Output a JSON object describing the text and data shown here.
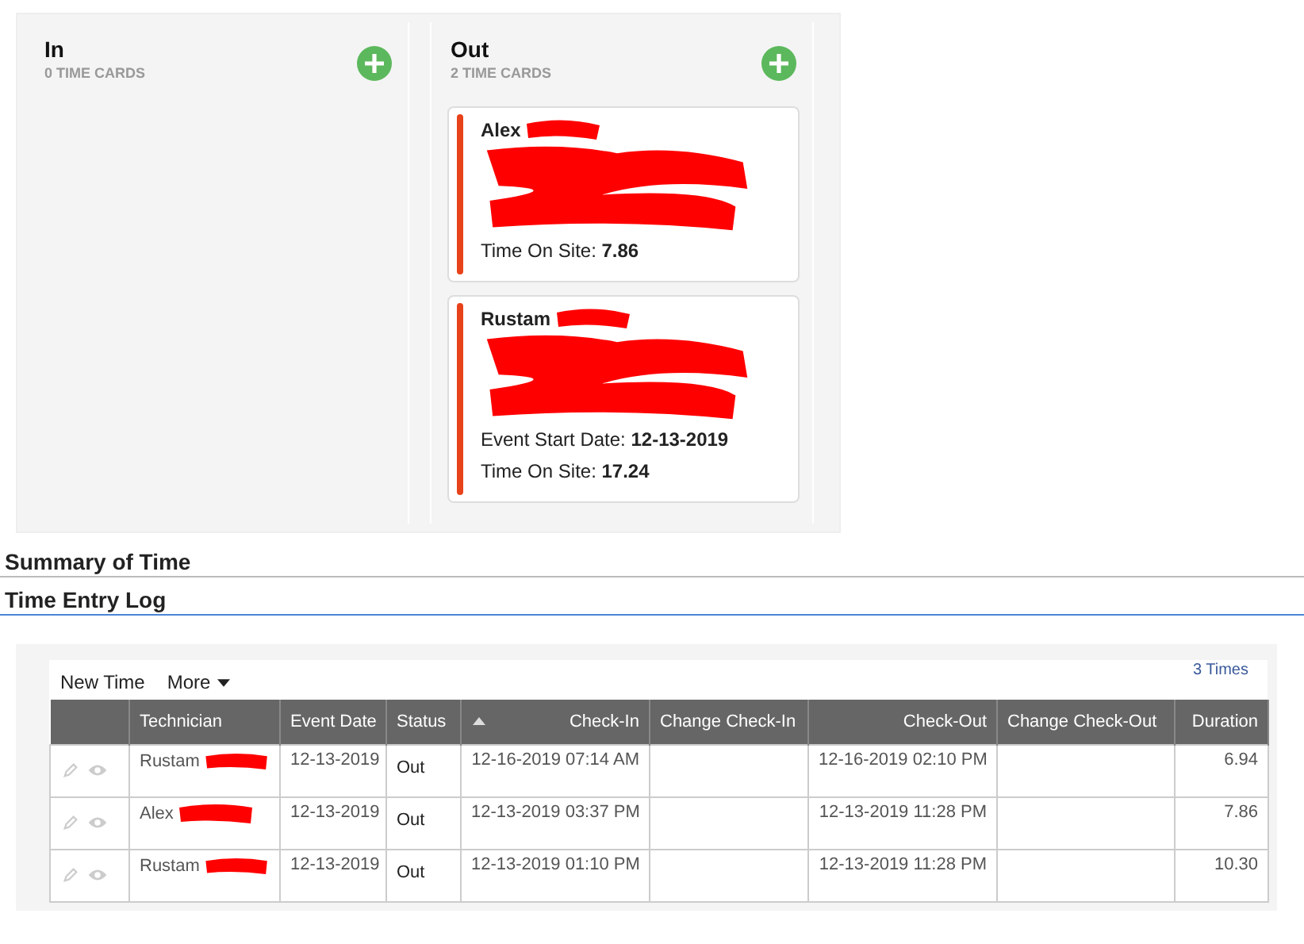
{
  "board": {
    "columns": [
      {
        "title": "In",
        "count": "0 TIME CARDS"
      },
      {
        "title": "Out",
        "count": "2 TIME CARDS",
        "cards": [
          {
            "name": "Alex",
            "redacted": true,
            "fields": [
              "Time On Site: **7.86**"
            ]
          },
          {
            "name": "Rustam",
            "redacted": true,
            "fields": [
              "Event Start Date: **12-13-2019**",
              "Time On Site: **17.24**"
            ]
          }
        ]
      }
    ]
  },
  "sections": [
    "Summary of Time",
    "Time Entry Log"
  ],
  "log": {
    "toolbar": {
      "new": "New Time",
      "more": "More",
      "count": "3 Times"
    },
    "columns": [
      {
        "sorted": false
      },
      {
        "label": "Technician",
        "sorted": false
      },
      {
        "label": "Event Date",
        "sorted": false
      },
      {
        "label": "Status",
        "sorted": false
      },
      {
        "label": "Check-In",
        "sorted": true
      },
      {
        "label": "Change Check-In",
        "sorted": false
      },
      {
        "label": "Check-Out",
        "sorted": false
      },
      {
        "label": "Change Check-Out",
        "sorted": false
      },
      {
        "label": "Duration",
        "sorted": false
      }
    ],
    "rows": [
      {
        "technician": "Rustam",
        "redacted": true,
        "event_date": "12-13-2019",
        "status": "Out",
        "check_in": "12-16-2019 07:14 AM",
        "check_out": "12-16-2019 02:10 PM",
        "duration": "6.94"
      },
      {
        "technician": "Alex",
        "redacted": true,
        "event_date": "12-13-2019",
        "status": "Out",
        "check_in": "12-13-2019 03:37 PM",
        "check_out": "12-13-2019 11:28 PM",
        "duration": "7.86"
      },
      {
        "technician": "Rustam",
        "redacted": true,
        "event_date": "12-13-2019",
        "status": "Out",
        "check_in": "12-13-2019 01:10 PM",
        "check_out": "12-13-2019 11:28 PM",
        "duration": "10.30"
      }
    ]
  }
}
